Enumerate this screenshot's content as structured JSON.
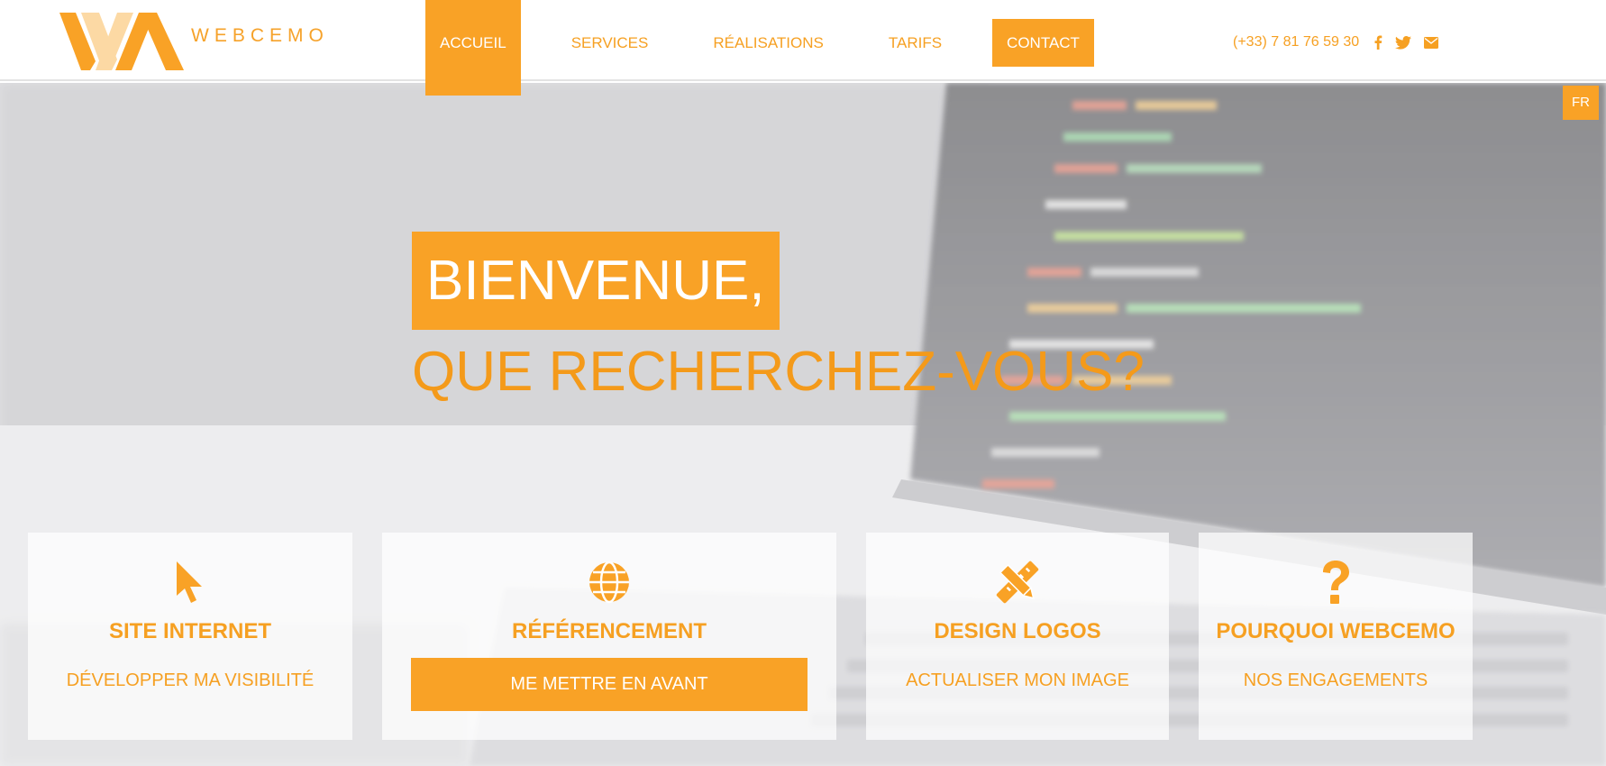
{
  "brand": {
    "name": "WEBCEMO",
    "accent": "#f9a226"
  },
  "nav": {
    "items": [
      {
        "label": "ACCUEIL"
      },
      {
        "label": "SERVICES"
      },
      {
        "label": "RÉALISATIONS"
      },
      {
        "label": "TARIFS"
      },
      {
        "label": "CONTACT"
      }
    ]
  },
  "header": {
    "phone": "(+33) 7 81 76 59 30",
    "social": [
      "facebook-icon",
      "twitter-icon",
      "envelope-icon"
    ]
  },
  "lang": "FR",
  "hero": {
    "welcome": "BIENVENUE,",
    "question": "QUE RECHERCHEZ-VOUS?"
  },
  "cards": [
    {
      "icon": "cursor-icon",
      "title": "SITE INTERNET",
      "action": "DÉVELOPPER MA VISIBILITÉ"
    },
    {
      "icon": "globe-icon",
      "title": "RÉFÉRENCEMENT",
      "action": "ME METTRE EN AVANT"
    },
    {
      "icon": "pencil-ruler-icon",
      "title": "DESIGN LOGOS",
      "action": "ACTUALISER MON IMAGE"
    },
    {
      "icon": "question-icon",
      "title": "POURQUOI WEBCEMO",
      "action": "NOS ENGAGEMENTS"
    }
  ]
}
